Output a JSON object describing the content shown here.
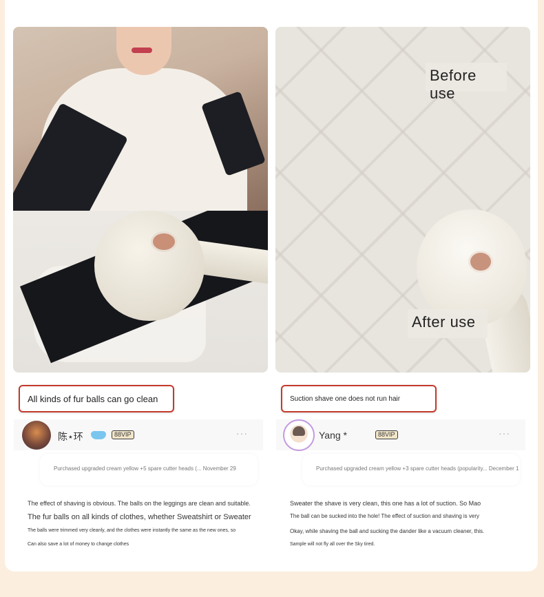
{
  "photos": {
    "before_label": "Before use",
    "after_label": "After use"
  },
  "captions": {
    "left": "All kinds of fur balls can go clean",
    "right": "Suction shave one does not run hair"
  },
  "reviews": [
    {
      "username": "陈⋆环",
      "vip": "88VIP",
      "more": "···",
      "purchase": "Purchased upgraded cream yellow +5 spare cutter heads (... November 29",
      "lines": [
        "The effect of shaving is obvious. The balls on the leggings are clean and suitable.",
        "The fur balls on all kinds of clothes, whether Sweatshirt or Sweater",
        "The balls were trimmed very cleanly, and the clothes were instantly the same as the new ones, so",
        "Can also save a lot of money to change clothes"
      ]
    },
    {
      "username": "Yang *",
      "vip": "88VIP",
      "more": "···",
      "purchase": "Purchased upgraded cream yellow +3 spare cutter heads (popularity... December 1",
      "lines": [
        "Sweater the shave is very clean, this one has a lot of suction. So Mao",
        "The ball can be sucked into the hole! The effect of suction and shaving is very",
        "Okay, while shaving the ball and sucking the dander like a vacuum cleaner, this.",
        "Sample will not fly all over the Sky tired."
      ]
    }
  ],
  "colors": {
    "background": "#fbeede",
    "caption_border": "#c4392b"
  }
}
